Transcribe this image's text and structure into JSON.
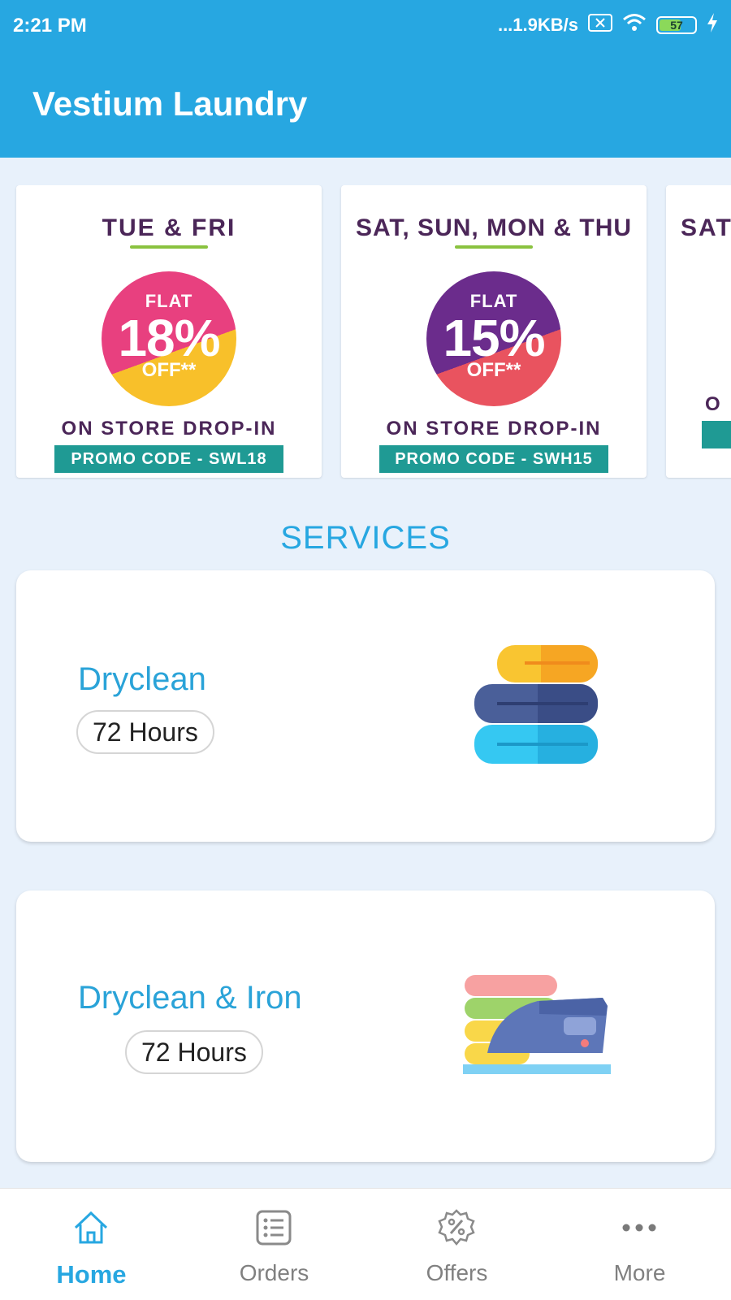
{
  "status_bar": {
    "time": "2:21 PM",
    "network_speed": "...1.9KB/s",
    "battery_level": "57",
    "icons": [
      "sim-off-icon",
      "wifi-icon",
      "battery-icon",
      "charging-icon"
    ]
  },
  "app_bar": {
    "title": "Vestium Laundry",
    "color": "#27a7e1"
  },
  "promos": [
    {
      "days": "TUE & FRI",
      "flat": "FLAT",
      "percent": "18%",
      "off": "OFF**",
      "drop_in": "ON STORE DROP-IN",
      "promo_code": "PROMO CODE - SWL18",
      "circle_colors": [
        "#e8407f",
        "#f8c02a"
      ]
    },
    {
      "days": "SAT, SUN, MON & THU",
      "flat": "FLAT",
      "percent": "15%",
      "off": "OFF**",
      "drop_in": "ON STORE DROP-IN",
      "promo_code": "PROMO CODE - SWH15",
      "circle_colors": [
        "#6b2c8c",
        "#e9535f"
      ]
    },
    {
      "days": "SAT",
      "drop_in": "O",
      "partial": true
    }
  ],
  "services": {
    "title": "SERVICES",
    "items": [
      {
        "name": "Dryclean",
        "turnaround": "72 Hours",
        "icon": "folded-towels-icon"
      },
      {
        "name": "Dryclean & Iron",
        "turnaround": "72 Hours",
        "icon": "iron-and-clothes-icon"
      }
    ]
  },
  "bottom_nav": {
    "active": "Home",
    "items": [
      {
        "label": "Home",
        "icon": "home-icon"
      },
      {
        "label": "Orders",
        "icon": "orders-list-icon"
      },
      {
        "label": "Offers",
        "icon": "offers-percent-icon"
      },
      {
        "label": "More",
        "icon": "more-dots-icon"
      }
    ]
  }
}
